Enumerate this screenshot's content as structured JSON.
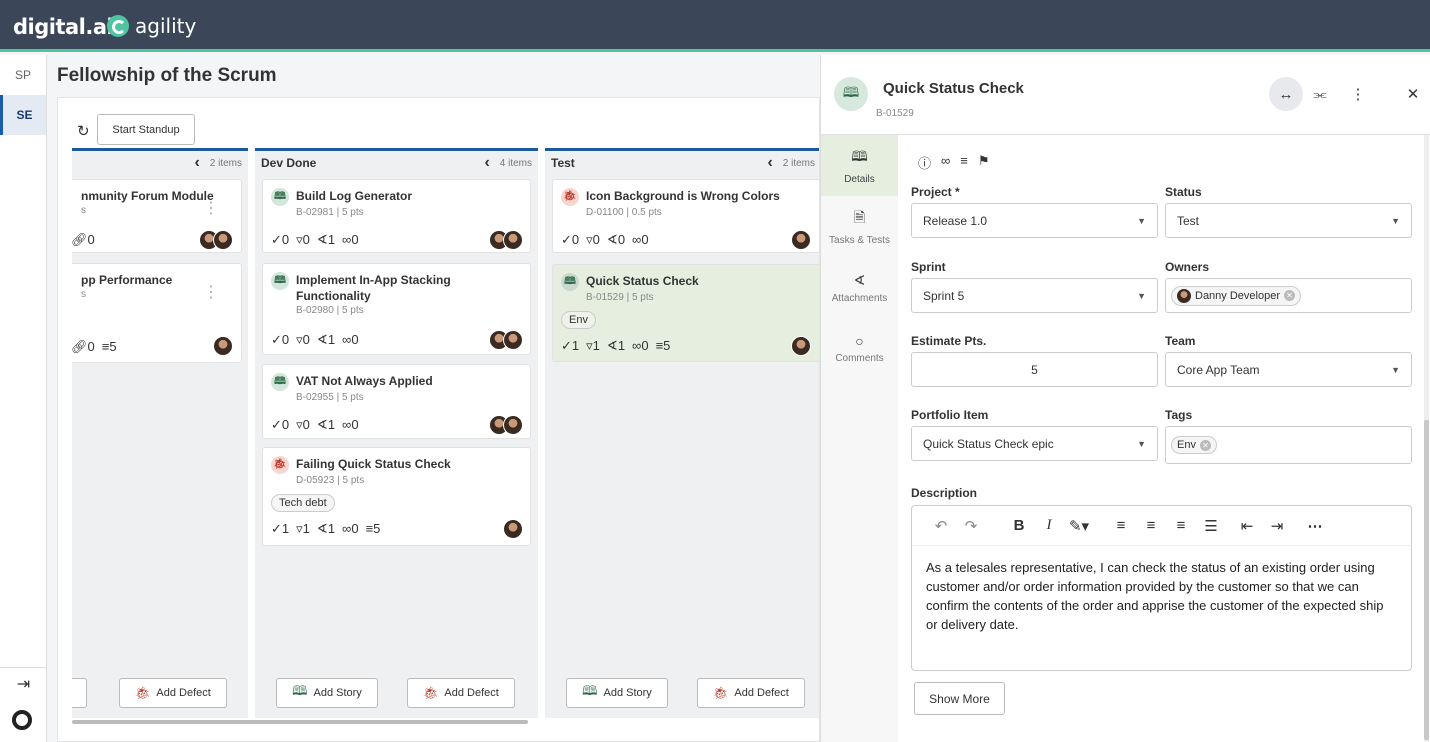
{
  "brand": {
    "company": "digital.ai",
    "product": "agility"
  },
  "nav": {
    "items": [
      {
        "label": "SP"
      },
      {
        "label": "SE"
      }
    ]
  },
  "page": {
    "title": "Fellowship of the Scrum"
  },
  "toolbar": {
    "standup_label": "Start Standup"
  },
  "columns": [
    {
      "name": "",
      "count": "2 items",
      "cards": [
        {
          "title": "nmunity Forum Module",
          "id": "s",
          "stats": [
            "0"
          ]
        },
        {
          "title": "pp Performance",
          "id": "s",
          "stats": [
            "0",
            "5"
          ]
        }
      ],
      "buttons": [
        "",
        "Add Defect"
      ]
    },
    {
      "name": "Dev Done",
      "count": "4 items",
      "cards": [
        {
          "title": "Build Log Generator",
          "id": "B-02981 | 5 pts",
          "stats": [
            "0",
            "0",
            "1",
            "0"
          ]
        },
        {
          "title": "Implement In-App Stacking Functionality",
          "id": "B-02980 | 5 pts",
          "stats": [
            "0",
            "0",
            "1",
            "0"
          ]
        },
        {
          "title": "VAT Not Always Applied",
          "id": "B-02955 | 5 pts",
          "stats": [
            "0",
            "0",
            "1",
            "0"
          ]
        },
        {
          "title": "Failing Quick Status Check",
          "id": "D-05923 | 5 pts",
          "tag": "Tech debt",
          "stats": [
            "1",
            "1",
            "1",
            "0",
            "5"
          ]
        }
      ],
      "buttons": [
        "Add Story",
        "Add Defect"
      ]
    },
    {
      "name": "Test",
      "count": "2 items",
      "cards": [
        {
          "title": "Icon Background is Wrong Colors",
          "id": "D-01100 | 0.5 pts",
          "stats": [
            "0",
            "0",
            "0",
            "0"
          ]
        },
        {
          "title": "Quick Status Check",
          "id": "B-01529 | 5 pts",
          "tag": "Env",
          "stats": [
            "1",
            "1",
            "1",
            "0",
            "5"
          ]
        }
      ],
      "buttons": [
        "Add Story",
        "Add Defect"
      ]
    }
  ],
  "panel": {
    "title": "Quick Status Check",
    "id": "B-01529",
    "tabs": [
      "Details",
      "Tasks & Tests",
      "Attachments",
      "Comments"
    ],
    "fields": {
      "project": {
        "label": "Project *",
        "value": "Release 1.0"
      },
      "status": {
        "label": "Status",
        "value": "Test"
      },
      "sprint": {
        "label": "Sprint",
        "value": "Sprint 5"
      },
      "owners": {
        "label": "Owners",
        "value": "Danny Developer"
      },
      "estimate": {
        "label": "Estimate Pts.",
        "value": "5"
      },
      "team": {
        "label": "Team",
        "value": "Core App Team"
      },
      "portfolio": {
        "label": "Portfolio Item",
        "value": "Quick Status Check epic"
      },
      "tags": {
        "label": "Tags",
        "value": "Env"
      }
    },
    "description_label": "Description",
    "description": "As a telesales representative, I can check the status of an existing order using customer and/or order information provided by the customer so that we can confirm the contents of the order and apprise the customer of the expected ship or delivery date.",
    "show_more": "Show More"
  },
  "colors": {
    "topbar": "#3b4658",
    "accent": "#4fc4a0",
    "column_border": "#1a5a9a",
    "selected_card": "#e6efdf"
  }
}
